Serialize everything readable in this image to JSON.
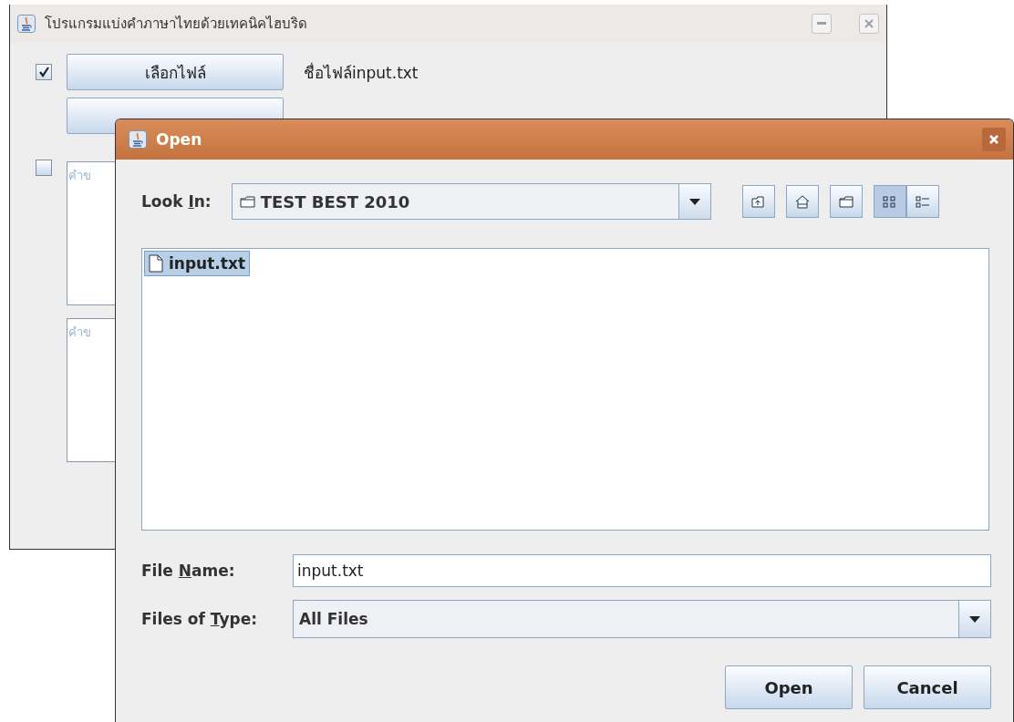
{
  "main_window": {
    "title": "โปรแกรมแบ่งคำภาษาไทยด้วยเทคนิคไฮบริด",
    "choose_file_button": "เลือกไฟล์",
    "file_label": "ชื่อไฟล์input.txt",
    "checkboxes": [
      {
        "checked": true
      },
      {
        "checked": false
      }
    ],
    "text_areas": [
      {
        "text": "คำข"
      },
      {
        "text": "คำข"
      }
    ]
  },
  "dialog": {
    "title": "Open",
    "look_in": {
      "label": [
        "Look ",
        "I",
        "n:"
      ],
      "value": "TEST BEST 2010"
    },
    "toolbar": [
      {
        "kind": "up",
        "selected": false
      },
      {
        "kind": "home",
        "selected": false
      },
      {
        "kind": "newfolder",
        "selected": false
      },
      {
        "kind": "list",
        "selected": true
      },
      {
        "kind": "details",
        "selected": false
      }
    ],
    "files": [
      {
        "name": "input.txt",
        "selected": true
      }
    ],
    "file_name": {
      "label": [
        "File ",
        "N",
        "ame:"
      ],
      "value": "input.txt"
    },
    "file_type": {
      "label": [
        "Files of ",
        "T",
        "ype:"
      ],
      "value": "All Files"
    },
    "buttons": [
      "Open",
      "Cancel"
    ]
  }
}
